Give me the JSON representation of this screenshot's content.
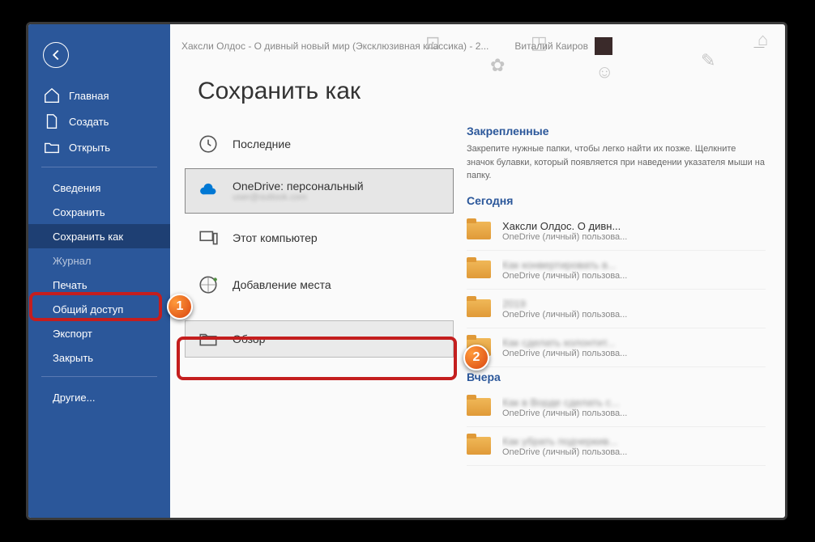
{
  "titlebar": {
    "doc_title": "Хаксли Олдос - О дивный новый мир (Эксклюзивная классика) - 2...",
    "user_name": "Виталий Каиров"
  },
  "page": {
    "heading": "Сохранить как"
  },
  "sidebar": {
    "home": "Главная",
    "new": "Создать",
    "open": "Открыть",
    "info": "Сведения",
    "save": "Сохранить",
    "save_as": "Сохранить как",
    "history": "Журнал",
    "print": "Печать",
    "share": "Общий доступ",
    "export": "Экспорт",
    "close": "Закрыть",
    "other": "Другие..."
  },
  "locations": {
    "recent": "Последние",
    "onedrive": "OneDrive: персональный",
    "onedrive_sub": "user@outlook.com",
    "this_pc": "Этот компьютер",
    "add_place": "Добавление места",
    "browse": "Обзор"
  },
  "right": {
    "pinned_h": "Закрепленные",
    "pinned_hint": "Закрепите нужные папки, чтобы легко найти их позже. Щелкните значок булавки, который появляется при наведении указателя мыши на папку.",
    "today_h": "Сегодня",
    "yesterday_h": "Вчера",
    "path": "OneDrive (личный) пользова...",
    "items_today": [
      {
        "name": "Хаксли Олдос. О дивн...",
        "blur": false
      },
      {
        "name": "Как конвертировать в...",
        "blur": true
      },
      {
        "name": "2019",
        "blur": true
      },
      {
        "name": "Как сделать колонтит...",
        "blur": true
      }
    ],
    "items_yesterday": [
      {
        "name": "Как в Ворде сделать с...",
        "blur": true
      },
      {
        "name": "Как убрать подчеркив...",
        "blur": true
      }
    ]
  },
  "badges": {
    "one": "1",
    "two": "2"
  }
}
